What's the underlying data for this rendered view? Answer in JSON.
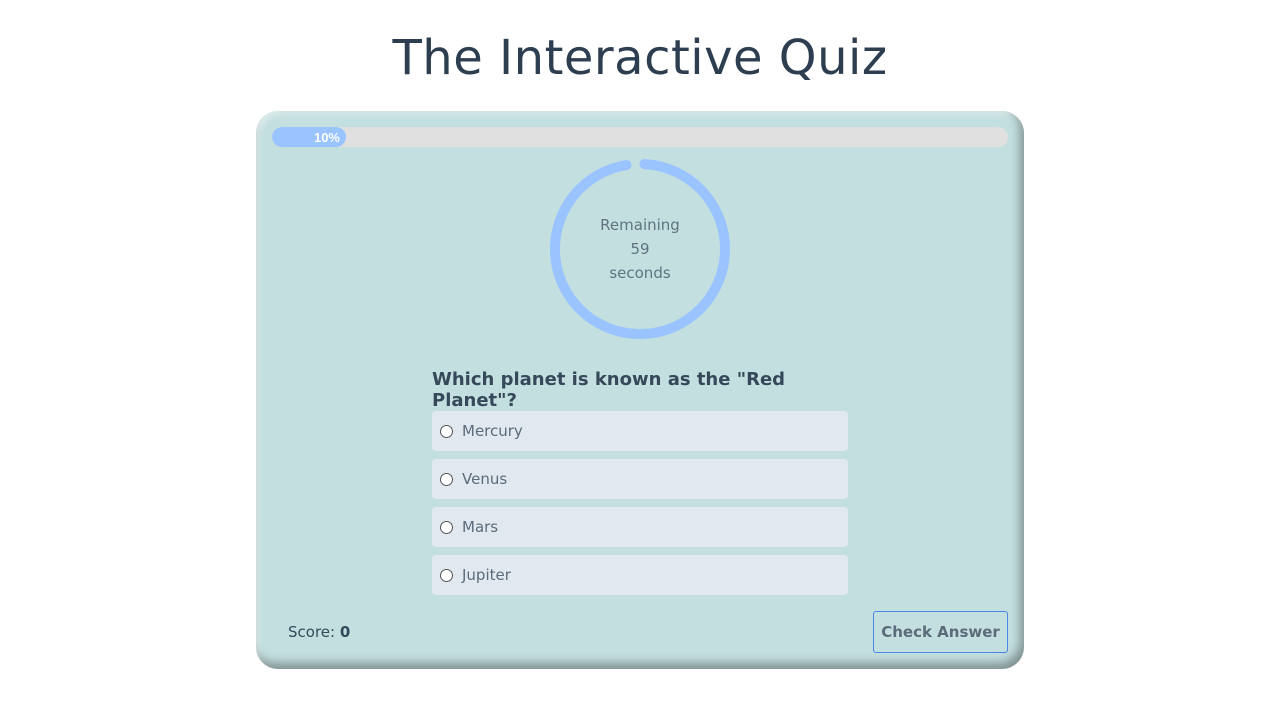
{
  "page": {
    "title": "The Interactive Quiz"
  },
  "progress": {
    "value": 0.1,
    "label": "10%"
  },
  "timer": {
    "line1": "Remaining",
    "seconds": "59",
    "line3": "seconds",
    "fraction_remaining": 0.983
  },
  "question": {
    "text": "Which planet is known as the \"Red Planet\"?",
    "options": [
      {
        "label": "Mercury"
      },
      {
        "label": "Venus"
      },
      {
        "label": "Mars"
      },
      {
        "label": "Jupiter"
      }
    ]
  },
  "score": {
    "label": "Score:",
    "value": "0"
  },
  "actions": {
    "check_label": "Check Answer"
  },
  "colors": {
    "card_background": "#c4dfe0",
    "accent": "#99c4ff",
    "track": "#e0e0e0",
    "option_background": "#e1e8ef",
    "button_border": "#4a86e8",
    "title_text": "#2c3e50"
  }
}
